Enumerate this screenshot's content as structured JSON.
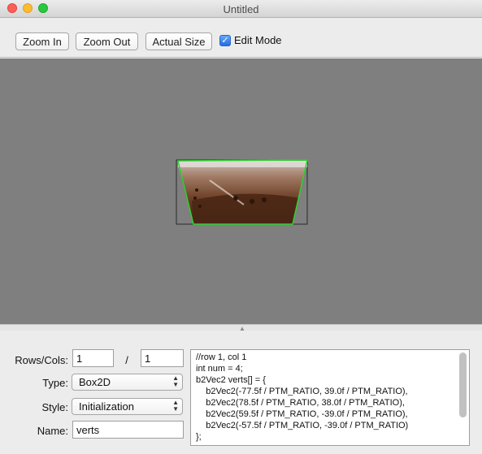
{
  "window": {
    "title": "Untitled"
  },
  "toolbar": {
    "zoom_in": "Zoom In",
    "zoom_out": "Zoom Out",
    "actual_size": "Actual Size",
    "edit_mode_label": "Edit Mode",
    "edit_mode_checked": true
  },
  "panel": {
    "rows_cols_label": "Rows/Cols:",
    "rows_value": "1",
    "cols_separator": "/",
    "cols_value": "1",
    "type_label": "Type:",
    "type_value": "Box2D",
    "style_label": "Style:",
    "style_value": "Initialization",
    "name_label": "Name:",
    "name_value": "verts"
  },
  "code": {
    "lines": [
      "//row 1, col 1",
      "int num = 4;",
      "b2Vec2 verts[] = {",
      "    b2Vec2(-77.5f / PTM_RATIO, 39.0f / PTM_RATIO),",
      "    b2Vec2(78.5f / PTM_RATIO, 38.0f / PTM_RATIO),",
      "    b2Vec2(59.5f / PTM_RATIO, -39.0f / PTM_RATIO),",
      "    b2Vec2(-57.5f / PTM_RATIO, -39.0f / PTM_RATIO)",
      "};"
    ]
  },
  "colors": {
    "canvas_bg": "#7f7f7f",
    "polygon_outline": "#2fd12f"
  }
}
